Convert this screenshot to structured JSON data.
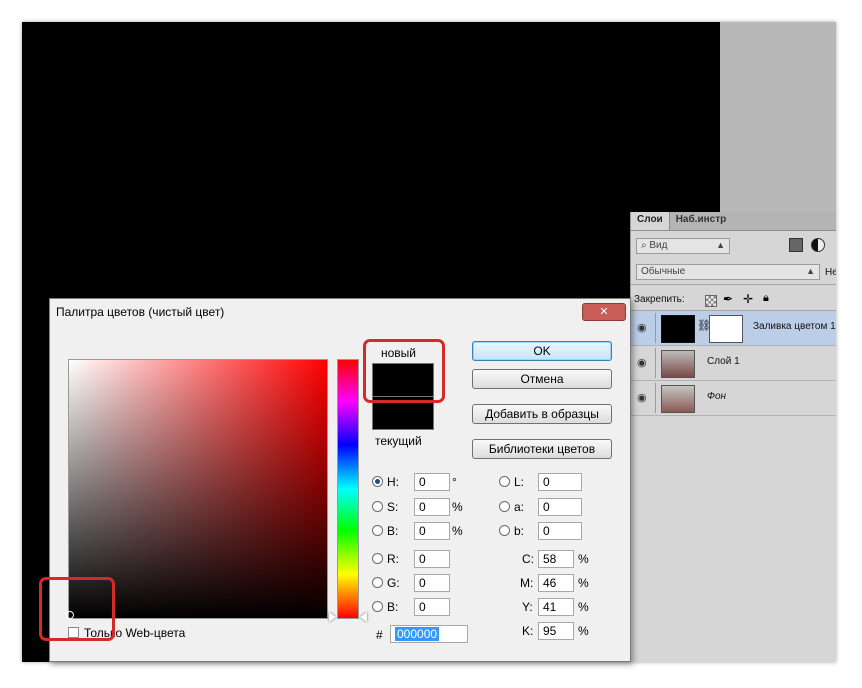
{
  "layers_panel": {
    "tabs": [
      "Слои",
      "Наб.инстр"
    ],
    "filter_label": "Вид",
    "blend_mode": "Обычные",
    "opacity_label_partial": "Не",
    "lock_label": "Закрепить:",
    "layers": [
      {
        "name": "Заливка цветом 1",
        "selected": true
      },
      {
        "name": "Слой 1",
        "selected": false
      },
      {
        "name": "Фон",
        "selected": false
      }
    ]
  },
  "dialog": {
    "title": "Палитра цветов (чистый цвет)",
    "new_label": "новый",
    "current_label": "текущий",
    "new_color": "#000000",
    "current_color": "#000000",
    "buttons": {
      "ok": "OK",
      "cancel": "Отмена",
      "add_to_swatches": "Добавить в образцы",
      "color_libraries": "Библиотеки цветов"
    },
    "hsb": [
      {
        "label": "H:",
        "value": "0",
        "unit": "°",
        "checked": true
      },
      {
        "label": "S:",
        "value": "0",
        "unit": "%",
        "checked": false
      },
      {
        "label": "B:",
        "value": "0",
        "unit": "%",
        "checked": false
      }
    ],
    "rgb": [
      {
        "label": "R:",
        "value": "0"
      },
      {
        "label": "G:",
        "value": "0"
      },
      {
        "label": "B:",
        "value": "0"
      }
    ],
    "lab": [
      {
        "label": "L:",
        "value": "0"
      },
      {
        "label": "a:",
        "value": "0"
      },
      {
        "label": "b:",
        "value": "0"
      }
    ],
    "cmyk": [
      {
        "label": "C:",
        "value": "58",
        "unit": "%"
      },
      {
        "label": "M:",
        "value": "46",
        "unit": "%"
      },
      {
        "label": "Y:",
        "value": "41",
        "unit": "%"
      },
      {
        "label": "K:",
        "value": "95",
        "unit": "%"
      }
    ],
    "hex_label": "#",
    "hex_value": "000000",
    "web_only_label": "Только Web-цвета"
  },
  "colors": {
    "highlight": "#d42a2a",
    "selection": "#bccde8"
  }
}
